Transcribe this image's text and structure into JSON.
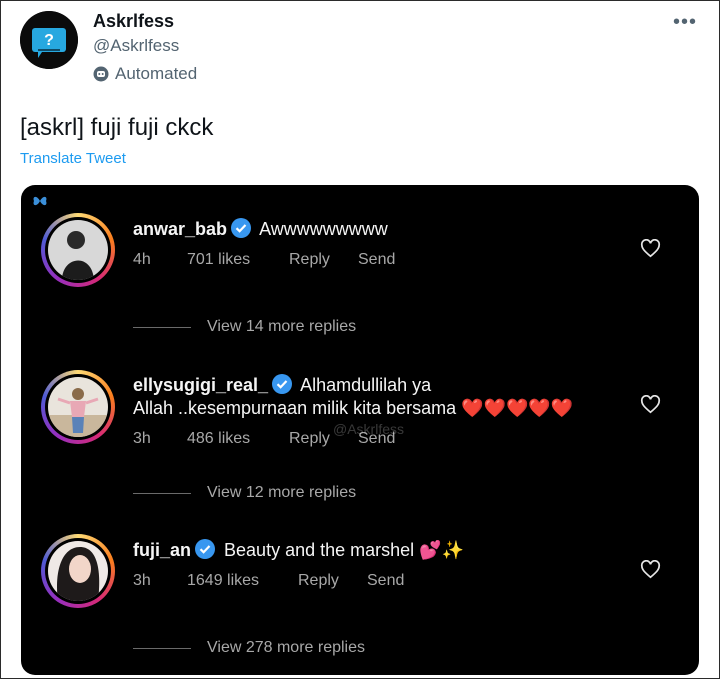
{
  "tweet": {
    "display_name": "Askrlfess",
    "handle": "@Askrlfess",
    "automated_label": "Automated",
    "text": "[askrl] fuji fuji ckck",
    "translate_label": "Translate Tweet",
    "more_icon": "more-options-icon"
  },
  "comments": [
    {
      "username": "anwar_bab",
      "text_lines": [
        "Awwwwwwwww"
      ],
      "time": "4h",
      "likes": "701 likes",
      "reply_label": "Reply",
      "send_label": "Send",
      "view_replies": "View 14 more replies"
    },
    {
      "username": "ellysugigi_real_",
      "text_lines": [
        "Alhamdullilah ya",
        "Allah ..kesempurnaan milik kita bersama ❤️❤️❤️❤️❤️"
      ],
      "time": "3h",
      "likes": "486 likes",
      "reply_label": "Reply",
      "send_label": "Send",
      "view_replies": "View 12 more replies"
    },
    {
      "username": "fuji_an",
      "text_lines": [
        "Beauty and the marshel 💕✨"
      ],
      "time": "3h",
      "likes": "1649 likes",
      "reply_label": "Reply",
      "send_label": "Send",
      "view_replies": "View 278 more replies"
    }
  ],
  "watermark": "@Askrlfess",
  "colors": {
    "link": "#1d9bf0",
    "verified": "#3897f0",
    "heart": "#ed2b3b"
  }
}
